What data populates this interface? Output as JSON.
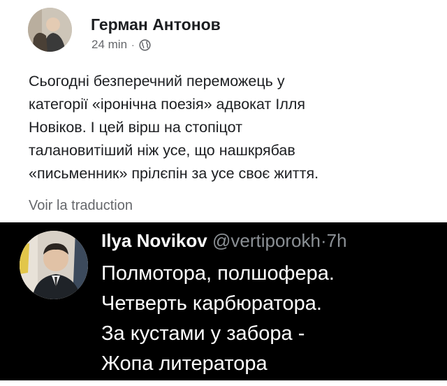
{
  "facebook_post": {
    "author": "Герман Антонов",
    "time": "24 min",
    "separator": "·",
    "privacy_icon": "globe-icon",
    "text_lines": [
      "Сьогодні безперечний переможець у",
      "категорії «іронічна поезія» адвокат Ілля",
      "Новіков. І цей вірш на стопіцот",
      "талановитіший ніж усе, що нашкрябав",
      "«письменник» прілєпін за усе своє життя."
    ],
    "translate_label": "Voir la traduction"
  },
  "tweet": {
    "name": "Ilya Novikov",
    "handle": "@vertiporokh",
    "separator": "·",
    "time": "7h",
    "lines": [
      "Полмотора, полшофера.",
      "Четверть карбюратора.",
      "За кустами у забора -",
      "Жопа литератора"
    ]
  },
  "colors": {
    "fb_text": "#1c1e21",
    "fb_muted": "#65676b",
    "tweet_bg": "#000000",
    "tweet_text": "#ffffff",
    "tweet_muted": "#8b9095"
  }
}
